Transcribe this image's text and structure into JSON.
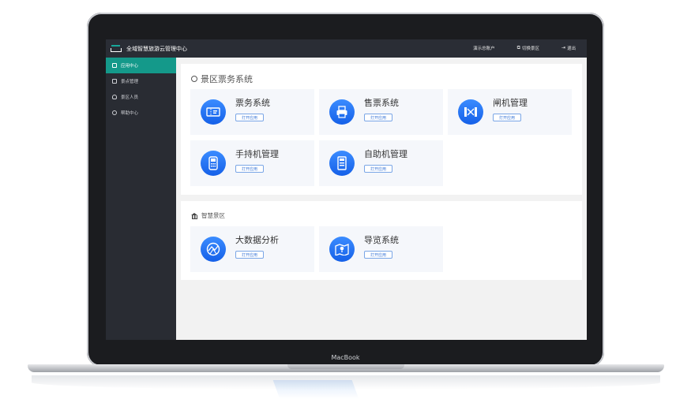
{
  "device": {
    "label": "MacBook"
  },
  "topbar": {
    "title": "全域智慧旅游云管理中心",
    "links": [
      {
        "label": "演示总账户",
        "icon": "none"
      },
      {
        "label": "切换景区",
        "icon": "switch-icon"
      },
      {
        "label": "退出",
        "icon": "logout-icon"
      }
    ]
  },
  "sidebar": {
    "items": [
      {
        "label": "应用中心",
        "icon": "grid-icon",
        "active": true
      },
      {
        "label": "景点管理",
        "icon": "grid-icon",
        "active": false
      },
      {
        "label": "景区人员",
        "icon": "person-icon",
        "active": false
      },
      {
        "label": "帮助中心",
        "icon": "help-icon",
        "active": false
      }
    ]
  },
  "sections": [
    {
      "title": "景区票务系统",
      "icon": "ticket-circle-icon",
      "apps": [
        {
          "name": "票务系统",
          "button": "打开应用",
          "icon": "ticket-icon"
        },
        {
          "name": "售票系统",
          "button": "打开应用",
          "icon": "printer-icon"
        },
        {
          "name": "闸机管理",
          "button": "打开应用",
          "icon": "gate-icon"
        },
        {
          "name": "手持机管理",
          "button": "打开应用",
          "icon": "handheld-icon"
        },
        {
          "name": "自助机管理",
          "button": "打开应用",
          "icon": "kiosk-icon"
        }
      ]
    },
    {
      "title": "智慧景区",
      "icon": "bank-icon",
      "apps": [
        {
          "name": "大数据分析",
          "button": "打开应用",
          "icon": "chart-icon"
        },
        {
          "name": "导览系统",
          "button": "打开应用",
          "icon": "map-icon"
        }
      ]
    }
  ],
  "colors": {
    "accent": "#14998a",
    "topbar": "#2a2d35",
    "sidebar": "#292c33",
    "iconBlue": "#1e6ff0"
  }
}
